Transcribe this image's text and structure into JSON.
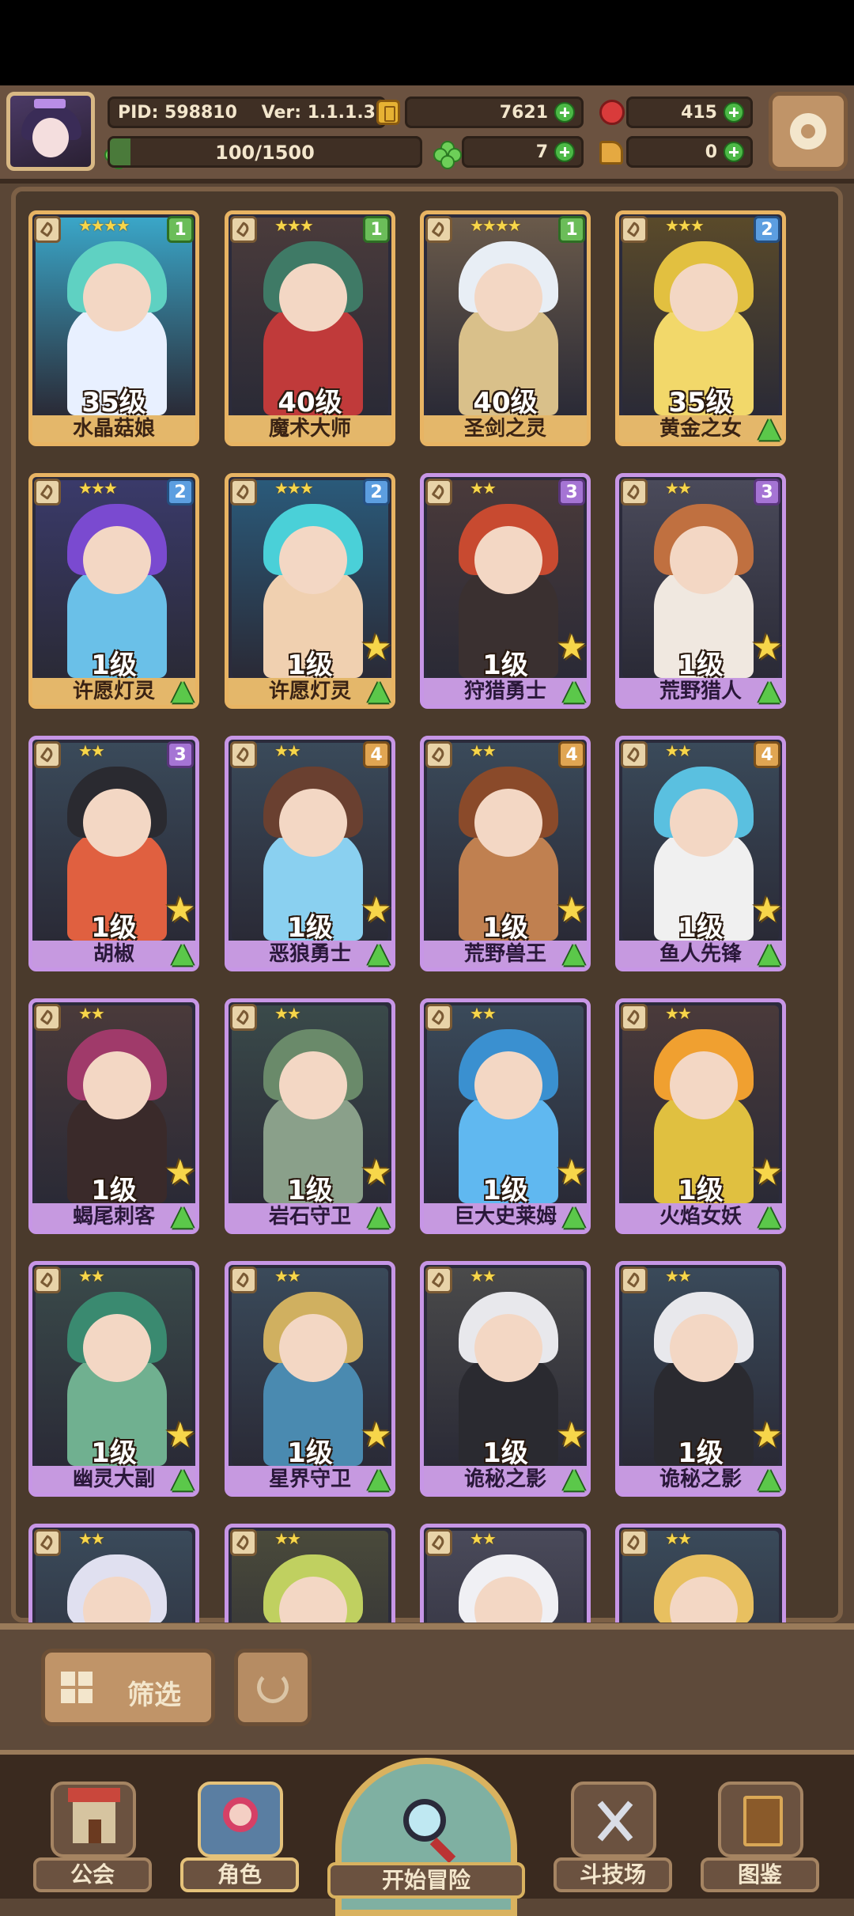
{
  "header": {
    "pid_label": "PID: 598810",
    "version_label": "Ver: 1.1.1.3",
    "gold": "7621",
    "gems": "415",
    "clovers": "7",
    "boots": "0",
    "stamina": "100/1500",
    "stamina_fraction": 0.067
  },
  "cards": [
    {
      "name": "水晶菇娘",
      "level": "35级",
      "rank": "1",
      "stars": "★★★★",
      "frame": "gold",
      "favorite": false,
      "upgrade": false,
      "art": [
        "#3aa6c8",
        "#5fd1c2",
        "#e8f0ff"
      ]
    },
    {
      "name": "魔术大师",
      "level": "40级",
      "rank": "1",
      "stars": "★★★",
      "frame": "gold",
      "favorite": false,
      "upgrade": false,
      "art": [
        "#4a3b3b",
        "#3f7a66",
        "#c03a3a"
      ]
    },
    {
      "name": "圣剑之灵",
      "level": "40级",
      "rank": "1",
      "stars": "★★★★",
      "frame": "gold",
      "favorite": false,
      "upgrade": false,
      "art": [
        "#6a5a4a",
        "#e8eef5",
        "#d9c08a"
      ]
    },
    {
      "name": "黄金之女",
      "level": "35级",
      "rank": "2",
      "stars": "★★★",
      "frame": "gold",
      "favorite": false,
      "upgrade": true,
      "art": [
        "#5a4a2a",
        "#e2c040",
        "#f2d86a"
      ]
    },
    {
      "name": "许愿灯灵",
      "level": "1级",
      "rank": "2",
      "stars": "★★★",
      "frame": "gold",
      "favorite": false,
      "upgrade": true,
      "art": [
        "#3a3a6a",
        "#7a4ad0",
        "#6ac0e8"
      ]
    },
    {
      "name": "许愿灯灵",
      "level": "1级",
      "rank": "2",
      "stars": "★★★",
      "frame": "gold",
      "favorite": true,
      "upgrade": true,
      "art": [
        "#2a5a7a",
        "#4ad0d8",
        "#f0d0b0"
      ]
    },
    {
      "name": "狩猎勇士",
      "level": "1级",
      "rank": "3",
      "stars": "★★",
      "frame": "purple",
      "favorite": true,
      "upgrade": true,
      "art": [
        "#4a3a3a",
        "#c84a30",
        "#3a3030"
      ]
    },
    {
      "name": "荒野猎人",
      "level": "1级",
      "rank": "3",
      "stars": "★★",
      "frame": "purple",
      "favorite": true,
      "upgrade": true,
      "art": [
        "#4a4a5a",
        "#c07040",
        "#f0e8e0"
      ]
    },
    {
      "name": "胡椒",
      "level": "1级",
      "rank": "3",
      "stars": "★★",
      "frame": "purple",
      "favorite": true,
      "upgrade": true,
      "art": [
        "#3a4a5a",
        "#2a2a30",
        "#e06040"
      ]
    },
    {
      "name": "恶狼勇士",
      "level": "1级",
      "rank": "4",
      "stars": "★★",
      "frame": "purple",
      "favorite": true,
      "upgrade": true,
      "art": [
        "#3a4a5a",
        "#6a4030",
        "#8ad0f0"
      ]
    },
    {
      "name": "荒野兽王",
      "level": "1级",
      "rank": "4",
      "stars": "★★",
      "frame": "purple",
      "favorite": true,
      "upgrade": true,
      "art": [
        "#3a4a5a",
        "#8a4a2a",
        "#c08050"
      ]
    },
    {
      "name": "鱼人先锋",
      "level": "1级",
      "rank": "4",
      "stars": "★★",
      "frame": "purple",
      "favorite": true,
      "upgrade": true,
      "art": [
        "#3a4a5a",
        "#5ac0e0",
        "#f0f0f0"
      ]
    },
    {
      "name": "蝎尾刺客",
      "level": "1级",
      "rank": "",
      "stars": "★★",
      "frame": "purple",
      "favorite": true,
      "upgrade": true,
      "art": [
        "#4a3a3a",
        "#a03a6a",
        "#3a2a2a"
      ]
    },
    {
      "name": "岩石守卫",
      "level": "1级",
      "rank": "",
      "stars": "★★",
      "frame": "purple",
      "favorite": true,
      "upgrade": true,
      "art": [
        "#3a4a4a",
        "#6a8a6a",
        "#8aa08a"
      ]
    },
    {
      "name": "巨大史莱姆",
      "level": "1级",
      "rank": "",
      "stars": "★★",
      "frame": "purple",
      "favorite": true,
      "upgrade": true,
      "art": [
        "#3a4a5a",
        "#3a90d0",
        "#60b8f0"
      ]
    },
    {
      "name": "火焰女妖",
      "level": "1级",
      "rank": "",
      "stars": "★★",
      "frame": "purple",
      "favorite": true,
      "upgrade": true,
      "art": [
        "#4a3a3a",
        "#f0a030",
        "#e0c040"
      ]
    },
    {
      "name": "幽灵大副",
      "level": "1级",
      "rank": "",
      "stars": "★★",
      "frame": "purple",
      "favorite": true,
      "upgrade": true,
      "art": [
        "#3a4a4a",
        "#3a8a70",
        "#70b090"
      ]
    },
    {
      "name": "星界守卫",
      "level": "1级",
      "rank": "",
      "stars": "★★",
      "frame": "purple",
      "favorite": true,
      "upgrade": true,
      "art": [
        "#3a4a5a",
        "#d0b060",
        "#4a8ab0"
      ]
    },
    {
      "name": "诡秘之影",
      "level": "1级",
      "rank": "",
      "stars": "★★",
      "frame": "purple",
      "favorite": true,
      "upgrade": true,
      "art": [
        "#4a4a4a",
        "#e8e8ec",
        "#2a2a30"
      ]
    },
    {
      "name": "诡秘之影",
      "level": "1级",
      "rank": "",
      "stars": "★★",
      "frame": "purple",
      "favorite": true,
      "upgrade": true,
      "art": [
        "#3a4a5a",
        "#e8e8ec",
        "#2a2a30"
      ]
    },
    {
      "name": "",
      "level": "",
      "rank": "",
      "stars": "★★",
      "frame": "purple",
      "favorite": false,
      "upgrade": false,
      "art": [
        "#3a4a5a",
        "#e0e0f0",
        "#c03a3a"
      ]
    },
    {
      "name": "",
      "level": "",
      "rank": "",
      "stars": "★★",
      "frame": "purple",
      "favorite": false,
      "upgrade": false,
      "art": [
        "#4a4a3a",
        "#c0d060",
        "#8a6030"
      ]
    },
    {
      "name": "",
      "level": "",
      "rank": "",
      "stars": "★★",
      "frame": "purple",
      "favorite": false,
      "upgrade": false,
      "art": [
        "#4a4a5a",
        "#f0f0f4",
        "#c0c0d0"
      ]
    },
    {
      "name": "",
      "level": "",
      "rank": "",
      "stars": "★★",
      "frame": "purple",
      "favorite": false,
      "upgrade": false,
      "art": [
        "#3a4a5a",
        "#e8c060",
        "#f0d090"
      ]
    }
  ],
  "controls": {
    "filter_label": "筛选"
  },
  "nav": {
    "guild": "公会",
    "characters": "角色",
    "adventure": "开始冒险",
    "arena": "斗技场",
    "codex": "图鉴"
  }
}
